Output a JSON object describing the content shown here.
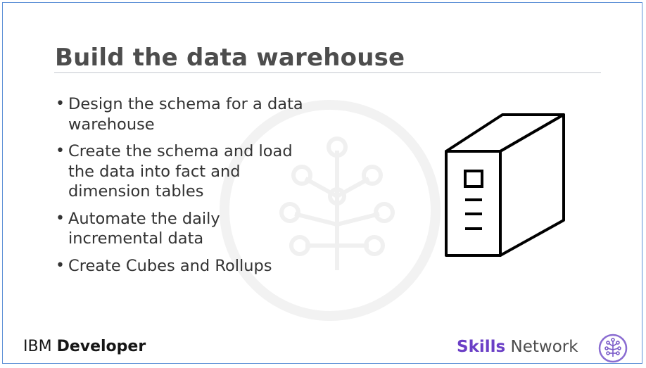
{
  "slide": {
    "title": "Build the data warehouse",
    "bullets": [
      {
        "lines": [
          "Design the schema for a data",
          "warehouse"
        ]
      },
      {
        "lines": [
          "Create the schema and load",
          "the data into fact and",
          "dimension tables"
        ]
      },
      {
        "lines": [
          "Automate the daily",
          "incremental data"
        ]
      },
      {
        "lines": [
          "Create Cubes and Rollups"
        ]
      }
    ],
    "illustration_icon": "server-tower-icon",
    "watermark_icon": "skills-network-tree-icon"
  },
  "footer": {
    "brand_left_light": "IBM",
    "brand_left_bold": "Developer",
    "brand_right_bold": "Skills",
    "brand_right_light": "Network",
    "logo_icon": "skills-network-logo-icon"
  },
  "colors": {
    "border": "#5b8fd6",
    "title": "#4d4d4d",
    "skills_purple": "#6b3fc6"
  }
}
